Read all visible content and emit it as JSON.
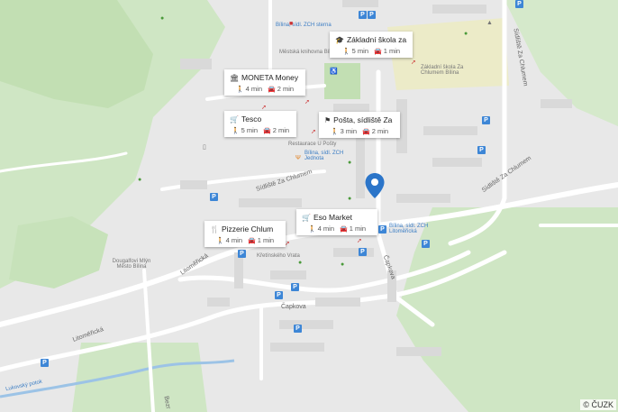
{
  "map": {
    "copyright": "© ČUZK",
    "colors": {
      "land": "#e8e8e8",
      "green": "#cfe6c4",
      "park": "#c2dfb3",
      "building": "#d9d9d9",
      "road": "#ffffff",
      "school": "#ecebc8",
      "water": "#9cc3e6",
      "parking": "#3d86d6",
      "pin": "#2b75c9"
    }
  },
  "cards": [
    {
      "id": "zakladni-skola",
      "icon": "graduation-cap-icon",
      "title": "Základní škola za...",
      "walk": "5 min",
      "drive": "1 min"
    },
    {
      "id": "moneta",
      "icon": "bank-icon",
      "title": "MONETA Money ...",
      "walk": "4 min",
      "drive": "2 min"
    },
    {
      "id": "tesco",
      "icon": "shopping-cart-icon",
      "title": "Tesco",
      "walk": "5 min",
      "drive": "2 min"
    },
    {
      "id": "posta",
      "icon": "post-office-icon",
      "title": "Pošta, sídliště Za ...",
      "walk": "3 min",
      "drive": "2 min"
    },
    {
      "id": "eso-market",
      "icon": "shopping-cart-icon",
      "title": "Eso Market",
      "walk": "4 min",
      "drive": "1 min"
    },
    {
      "id": "pizzerie",
      "icon": "restaurant-icon",
      "title": "Pizzerie Chlum",
      "walk": "4 min",
      "drive": "1 min"
    }
  ],
  "labels": {
    "bilina_zch_sterna": "Bílina, sídl. ZCH sterna",
    "knihovna": "Městská knihovna Bílina",
    "skola_lbl": "Základní škola Za Chlumem Bílina",
    "restaurace": "Restaurace U Pošty",
    "bilina_jednota": "Bílina, sídl. ZCH Jednota",
    "bilina_litomericka": "Bílina, sídl. ZCH Litoměřická",
    "sidliste_za_chlumem_1": "Sídliště Za Chlumem",
    "sidliste_za_chlumem_2": "Sídliště Za Chlumem",
    "sidliste_za_chlumem_3": "Sídliště Za Chlumem",
    "kretinsky": "Křetínského Vrata",
    "dougalfovi": "Dougalfovi Mlýn Město Bílina",
    "litomericka_1": "Litoměřická",
    "litomericka_2": "Litoměřická",
    "capkova_1": "Čapkova",
    "capkova_2": "Čapkova",
    "lukovsky_potok": "Lukovský potok",
    "bezr": "Bezr"
  }
}
